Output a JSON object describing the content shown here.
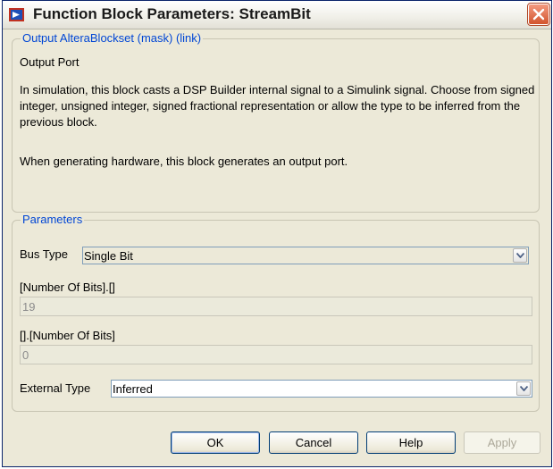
{
  "window": {
    "title": "Function Block Parameters: StreamBit"
  },
  "mask_group": {
    "legend": "Output AlteraBlockset (mask) (link)",
    "block_name": "Output Port",
    "description_1": "In simulation, this block casts a DSP Builder internal signal to a Simulink signal. Choose from signed integer, unsigned integer, signed fractional representation or allow the type to be inferred from the previous block.",
    "description_2": "When generating hardware, this block generates an output port."
  },
  "params_group": {
    "legend": "Parameters",
    "bus_type": {
      "label": "Bus Type",
      "value": "Single Bit"
    },
    "int_bits": {
      "label": "[Number Of Bits].[]",
      "value": "19"
    },
    "frac_bits": {
      "label": "[].[Number Of Bits]",
      "value": "0"
    },
    "external_type": {
      "label": "External Type",
      "value": "Inferred"
    }
  },
  "buttons": {
    "ok": "OK",
    "cancel": "Cancel",
    "help": "Help",
    "apply": "Apply"
  },
  "icons": {
    "app": "simulink-block-icon",
    "close": "close-icon",
    "dropdown": "chevron-down-icon"
  },
  "colors": {
    "legend": "#0046d5",
    "close": "#d2542e",
    "dialog_bg": "#ece9d8"
  }
}
